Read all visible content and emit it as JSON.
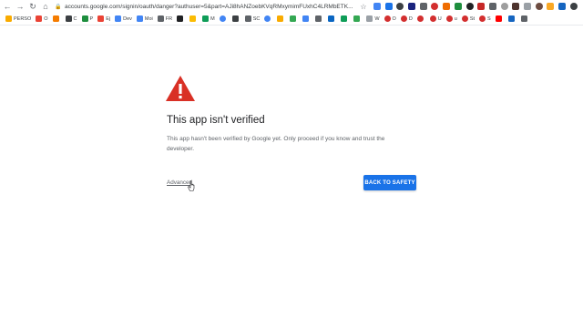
{
  "browser": {
    "url": "accounts.google.com/signin/oauth/danger?authuser=5&part=AJi8hANZoebKVqRMxymimFUxhC4LRMbETK...",
    "extension_colors": [
      "#4285f4",
      "#1a73e8",
      "#3c4043",
      "#1a237e",
      "#5f6368",
      "#d32f2f",
      "#ef6c00",
      "#1e8e3e",
      "#202124",
      "#c62828",
      "#5f6368",
      "#9e9e9e",
      "#4e342e",
      "#9aa0a6",
      "#6d4c41",
      "#f9a825",
      "#1565c0",
      "#3c4043"
    ]
  },
  "bookmarks": [
    {
      "label": "PERSO",
      "icon": "folder-icon",
      "color": "#f9ab00"
    },
    {
      "label": "O",
      "icon": "gmail-icon",
      "color": "#ea4335"
    },
    {
      "label": "",
      "icon": "orange-app-icon",
      "color": "#f57c00"
    },
    {
      "label": "C",
      "icon": "slash-c-icon",
      "color": "#3c4043"
    },
    {
      "label": "P",
      "icon": "plus-green-icon",
      "color": "#1e8e3e"
    },
    {
      "label": "Ej",
      "icon": "gmail-icon",
      "color": "#ea4335"
    },
    {
      "label": "Dev",
      "icon": "docs-icon",
      "color": "#4285f4"
    },
    {
      "label": "Moi",
      "icon": "docs-icon",
      "color": "#4285f4"
    },
    {
      "label": "FR",
      "icon": "gear-icon",
      "color": "#5f6368"
    },
    {
      "label": "",
      "icon": "amazon-icon",
      "color": "#202124"
    },
    {
      "label": "",
      "icon": "c-yellow-icon",
      "color": "#fbbc04"
    },
    {
      "label": "M",
      "icon": "sheet-icon",
      "color": "#0f9d58"
    },
    {
      "label": "",
      "icon": "google-icon",
      "color": "#4285f4"
    },
    {
      "label": "",
      "icon": "dash-icon",
      "color": "#3c4043"
    },
    {
      "label": "SC",
      "icon": "puzzle-icon",
      "color": "#5f6368"
    },
    {
      "label": "",
      "icon": "google-icon",
      "color": "#4285f4"
    },
    {
      "label": "",
      "icon": "analytics-icon",
      "color": "#f9ab00"
    },
    {
      "label": "",
      "icon": "drive-icon",
      "color": "#34a853"
    },
    {
      "label": "",
      "icon": "ads-icon",
      "color": "#4285f4"
    },
    {
      "label": "",
      "icon": "mail-icon",
      "color": "#5f6368"
    },
    {
      "label": "",
      "icon": "linkedin-icon",
      "color": "#0a66c2"
    },
    {
      "label": "",
      "icon": "grid-icon",
      "color": "#0f9d58"
    },
    {
      "label": "",
      "icon": "list-icon",
      "color": "#34a853"
    },
    {
      "label": "W",
      "icon": "doc-icon",
      "color": "#9aa0a6"
    },
    {
      "label": "O",
      "icon": "stripe-icon",
      "color": "#d32f2f"
    },
    {
      "label": "D",
      "icon": "stripe-icon",
      "color": "#d32f2f"
    },
    {
      "label": "",
      "icon": "stripe-icon",
      "color": "#d32f2f"
    },
    {
      "label": "U",
      "icon": "stripe-icon",
      "color": "#d32f2f"
    },
    {
      "label": "u",
      "icon": "stripe-icon",
      "color": "#d32f2f"
    },
    {
      "label": "St",
      "icon": "stripe-icon",
      "color": "#d32f2f"
    },
    {
      "label": "S",
      "icon": "stripe-icon",
      "color": "#d32f2f"
    },
    {
      "label": "",
      "icon": "youtube-icon",
      "color": "#ff0000"
    },
    {
      "label": "",
      "icon": "play-icon",
      "color": "#1565c0"
    },
    {
      "label": "",
      "icon": "globe-icon",
      "color": "#5f6368"
    }
  ],
  "page": {
    "title": "This app isn't verified",
    "description": "This app hasn't been verified by Google yet. Only proceed if you know and trust the developer.",
    "advanced_label": "Advanced",
    "back_button_label": "BACK TO SAFETY",
    "warning_color": "#d93025",
    "button_color": "#1a73e8"
  }
}
